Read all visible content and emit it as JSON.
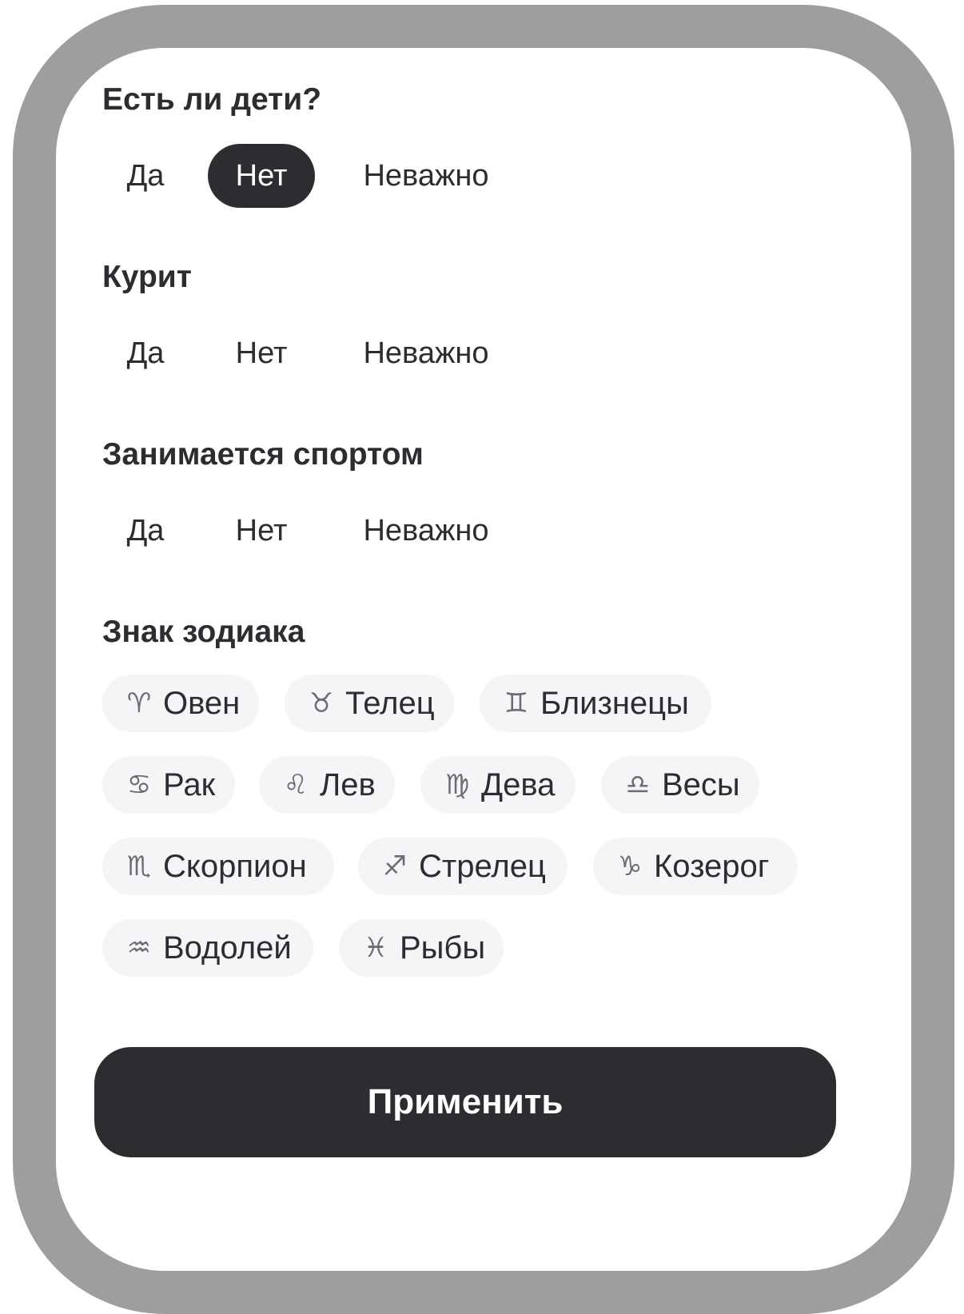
{
  "sections": [
    {
      "title": "Есть ли дети?",
      "options": [
        "Да",
        "Нет",
        "Неважно"
      ],
      "selected": "Нет"
    },
    {
      "title": "Курит",
      "options": [
        "Да",
        "Нет",
        "Неважно"
      ],
      "selected": null
    },
    {
      "title": "Занимается спортом",
      "options": [
        "Да",
        "Нет",
        "Неважно"
      ],
      "selected": null
    }
  ],
  "zodiac": {
    "title": "Знак зодиака",
    "signs": [
      {
        "symbol": "♈",
        "label": "Овен",
        "icon": "aries-icon"
      },
      {
        "symbol": "♉",
        "label": "Телец",
        "icon": "taurus-icon"
      },
      {
        "symbol": "♊",
        "label": "Близнецы",
        "icon": "gemini-icon"
      },
      {
        "symbol": "♋",
        "label": "Рак",
        "icon": "cancer-icon"
      },
      {
        "symbol": "♌",
        "label": "Лев",
        "icon": "leo-icon"
      },
      {
        "symbol": "♍",
        "label": "Дева",
        "icon": "virgo-icon"
      },
      {
        "symbol": "♎",
        "label": "Весы",
        "icon": "libra-icon"
      },
      {
        "symbol": "♏",
        "label": "Скорпион",
        "icon": "scorpio-icon"
      },
      {
        "symbol": "♐",
        "label": "Стрелец",
        "icon": "sagittarius-icon"
      },
      {
        "symbol": "♑",
        "label": "Козерог",
        "icon": "capricorn-icon"
      },
      {
        "symbol": "♒",
        "label": "Водолей",
        "icon": "aquarius-icon"
      },
      {
        "symbol": "♓",
        "label": "Рыбы",
        "icon": "pisces-icon"
      }
    ]
  },
  "apply_label": "Применить",
  "colors": {
    "accent_dark": "#2c2d30",
    "chip_bg": "#f4f5f6",
    "frame_border": "#9e9e9e"
  }
}
